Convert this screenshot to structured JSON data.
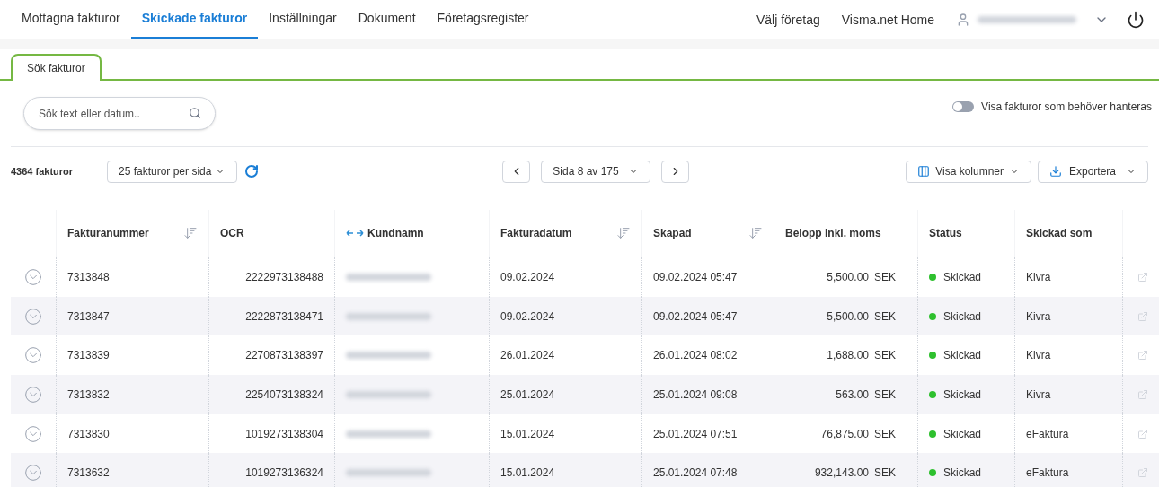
{
  "nav": {
    "items": [
      {
        "label": "Mottagna fakturor",
        "selected": false
      },
      {
        "label": "Skickade fakturor",
        "selected": true
      },
      {
        "label": "Inställningar",
        "selected": false
      },
      {
        "label": "Dokument",
        "selected": false
      },
      {
        "label": "Företagsregister",
        "selected": false
      }
    ],
    "right_links": [
      "Välj företag",
      "Visma.net Home"
    ]
  },
  "tabs": [
    {
      "label": "Sök fakturor",
      "selected": true
    }
  ],
  "search": {
    "placeholder": "Sök text eller datum.."
  },
  "toggle": {
    "label": "Visa fakturor som behöver hanteras",
    "on": false
  },
  "toolbar": {
    "count": "4364 fakturor",
    "per_page": "25 fakturor per sida",
    "page": "Sida 8 av 175",
    "columns_button": "Visa kolumner",
    "export_button": "Exportera"
  },
  "table": {
    "columns": [
      {
        "label": "Fakturanummer",
        "kind": "sort"
      },
      {
        "label": "OCR",
        "kind": "plain"
      },
      {
        "label": "Kundnamn",
        "kind": "swap"
      },
      {
        "label": "Fakturadatum",
        "kind": "sort"
      },
      {
        "label": "Skapad",
        "kind": "sort"
      },
      {
        "label": "Belopp inkl. moms",
        "kind": "plain"
      },
      {
        "label": "Status",
        "kind": "plain"
      },
      {
        "label": "Skickad som",
        "kind": "plain"
      }
    ],
    "rows": [
      {
        "number": "7313848",
        "ocr": "2222973138488",
        "date": "09.02.2024",
        "created": "09.02.2024 05:47",
        "amount": "5,500.00",
        "currency": "SEK",
        "status": "Skickad",
        "sent_as": "Kivra"
      },
      {
        "number": "7313847",
        "ocr": "2222873138471",
        "date": "09.02.2024",
        "created": "09.02.2024 05:47",
        "amount": "5,500.00",
        "currency": "SEK",
        "status": "Skickad",
        "sent_as": "Kivra"
      },
      {
        "number": "7313839",
        "ocr": "2270873138397",
        "date": "26.01.2024",
        "created": "26.01.2024 08:02",
        "amount": "1,688.00",
        "currency": "SEK",
        "status": "Skickad",
        "sent_as": "Kivra"
      },
      {
        "number": "7313832",
        "ocr": "2254073138324",
        "date": "25.01.2024",
        "created": "25.01.2024 09:08",
        "amount": "563.00",
        "currency": "SEK",
        "status": "Skickad",
        "sent_as": "Kivra"
      },
      {
        "number": "7313830",
        "ocr": "1019273138304",
        "date": "15.01.2024",
        "created": "25.01.2024 07:51",
        "amount": "76,875.00",
        "currency": "SEK",
        "status": "Skickad",
        "sent_as": "eFaktura"
      },
      {
        "number": "7313632",
        "ocr": "1019273136324",
        "date": "15.01.2024",
        "created": "25.01.2024 07:48",
        "amount": "932,143.00",
        "currency": "SEK",
        "status": "Skickad",
        "sent_as": "eFaktura"
      }
    ]
  }
}
